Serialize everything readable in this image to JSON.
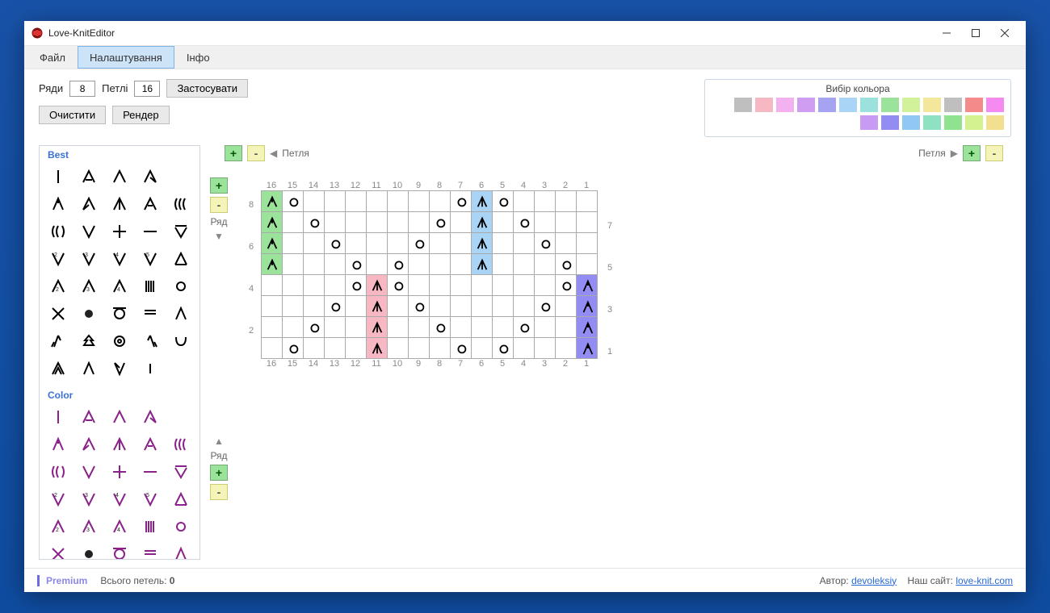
{
  "window": {
    "title": "Love-KnitEditor"
  },
  "menubar": {
    "tabs": [
      {
        "label": "Файл",
        "selected": false
      },
      {
        "label": "Налаштування",
        "selected": true
      },
      {
        "label": "Інфо",
        "selected": false
      }
    ]
  },
  "toolbar": {
    "rows_label": "Ряди",
    "rows_value": "8",
    "cols_label": "Петлі",
    "cols_value": "16",
    "apply": "Застосувати",
    "clear": "Очистити",
    "render": "Рендер"
  },
  "color_picker": {
    "title": "Вибір кольора",
    "row1": [
      "#bfbfbf",
      "#f6b9c3",
      "#f3b1f0",
      "#cf9ef3",
      "#a6a3f3",
      "#a9d4f5",
      "#9be2de",
      "#9be29b",
      "#d1f29b",
      "#f2e79b",
      "#bfbfbf",
      "#f58a8a",
      "#f58af0"
    ],
    "row2": [
      "#c79bf3",
      "#938df3",
      "#8fc8f3",
      "#8fe2c1",
      "#8fe28f",
      "#d4f28f",
      "#f2df8f"
    ]
  },
  "palette": {
    "section1": "Best",
    "section2": "Color",
    "symbols_best": [
      "vbar",
      "tri1",
      "up",
      "triR",
      "empty",
      "lambda",
      "triL",
      "up2",
      "triS",
      "coil",
      "coil2",
      "vee",
      "plus",
      "hbar",
      "veeU",
      "vee2",
      "vee3",
      "vee4",
      "vee5",
      "triU",
      "tri2u",
      "tri3u",
      "tri4u",
      "bars",
      "circle",
      "xmark",
      "dot",
      "ocirc",
      "ubar",
      "lamR",
      "arrowL",
      "pine",
      "ocirc2",
      "arrowR",
      "hooks",
      "triS2",
      "lambda2",
      "triR2",
      "vbar2",
      "empty2"
    ],
    "symbols_color": [
      "vbar",
      "tri1",
      "up",
      "triR",
      "empty",
      "lambda",
      "triL",
      "up2",
      "triS",
      "coil",
      "coil2",
      "vee",
      "plus",
      "hbar",
      "veeU",
      "vee2",
      "vee3",
      "vee4",
      "vee5",
      "triU",
      "tri2u",
      "tri3u",
      "tri4u",
      "bars",
      "circle",
      "xmark",
      "dot",
      "ocirc",
      "ubar",
      "lamR"
    ]
  },
  "canvas": {
    "loop_label": "Петля",
    "row_label": "Ряд",
    "top_loop_left_plus": "+",
    "top_loop_left_minus": "-",
    "col_count": 16,
    "row_count": 8,
    "row_labels_left": [
      "8",
      "",
      "6",
      "",
      "4",
      "",
      "2",
      ""
    ],
    "row_labels_right": [
      "",
      "7",
      "",
      "5",
      "",
      "3",
      "",
      "1"
    ],
    "cells": {
      "r8": {
        "16": {
          "s": "joinL",
          "bg": "green"
        },
        "15": {
          "s": "circle"
        },
        "7": {
          "s": "circle"
        },
        "6": {
          "s": "joinUp",
          "bg": "blue"
        },
        "5": {
          "s": "circle"
        }
      },
      "r7": {
        "16": {
          "s": "joinL",
          "bg": "green"
        },
        "14": {
          "s": "circle"
        },
        "8": {
          "s": "circle"
        },
        "6": {
          "s": "joinUp",
          "bg": "blue"
        },
        "4": {
          "s": "circle"
        }
      },
      "r6": {
        "16": {
          "s": "joinL",
          "bg": "green"
        },
        "13": {
          "s": "circle"
        },
        "9": {
          "s": "circle"
        },
        "6": {
          "s": "joinUp",
          "bg": "blue"
        },
        "3": {
          "s": "circle"
        }
      },
      "r5": {
        "16": {
          "s": "joinL",
          "bg": "green"
        },
        "12": {
          "s": "circle"
        },
        "10": {
          "s": "circle"
        },
        "6": {
          "s": "joinUp",
          "bg": "blue"
        },
        "2": {
          "s": "circle"
        }
      },
      "r4": {
        "12": {
          "s": "circle"
        },
        "11": {
          "s": "joinUp",
          "bg": "pink"
        },
        "10": {
          "s": "circle"
        },
        "2": {
          "s": "circle"
        },
        "1": {
          "s": "lambda",
          "bg": "purple"
        }
      },
      "r3": {
        "13": {
          "s": "circle"
        },
        "11": {
          "s": "joinUp",
          "bg": "pink"
        },
        "9": {
          "s": "circle"
        },
        "3": {
          "s": "circle"
        },
        "1": {
          "s": "lambda",
          "bg": "purple"
        }
      },
      "r2": {
        "14": {
          "s": "circle"
        },
        "11": {
          "s": "joinUp",
          "bg": "pink"
        },
        "8": {
          "s": "circle"
        },
        "4": {
          "s": "circle"
        },
        "1": {
          "s": "lambda",
          "bg": "purple"
        }
      },
      "r1": {
        "15": {
          "s": "circle"
        },
        "11": {
          "s": "joinUp",
          "bg": "pink"
        },
        "7": {
          "s": "circle"
        },
        "5": {
          "s": "circle"
        },
        "1": {
          "s": "lambda",
          "bg": "purple"
        }
      }
    }
  },
  "footer": {
    "premium": "Premium",
    "stitch_count_label": "Всього петель:",
    "stitch_count_value": "0",
    "author_label": "Автор:",
    "author_link": "devoleksiy",
    "site_label": "Наш сайт:",
    "site_link": "love-knit.com"
  }
}
